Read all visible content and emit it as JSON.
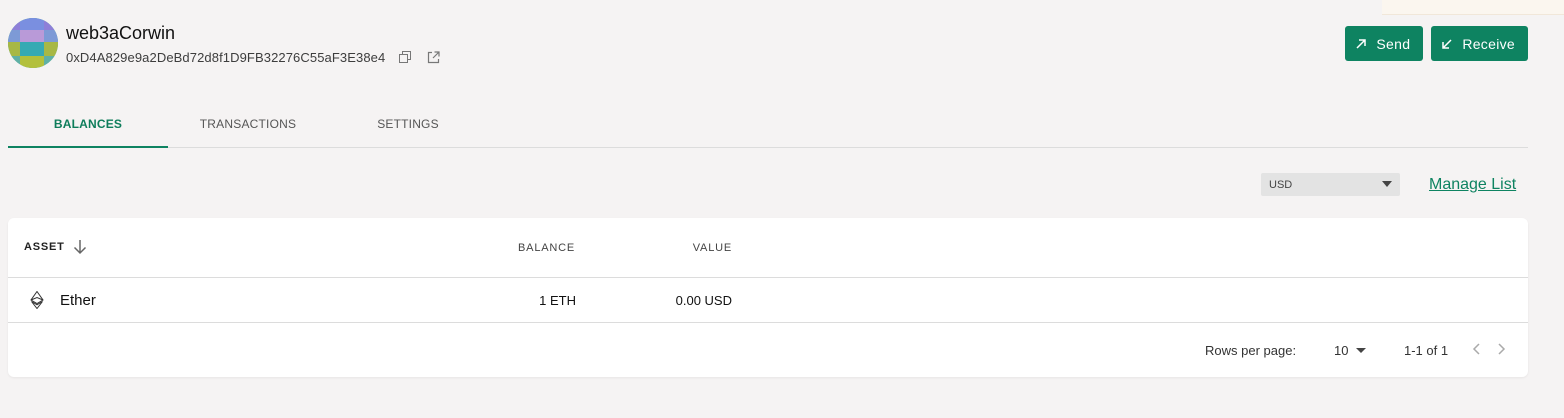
{
  "account": {
    "name": "web3aCorwin",
    "address": "0xD4A829e9a2DeBd72d8f1D9FB32276C55aF3E38e4"
  },
  "actions": {
    "send_label": "Send",
    "receive_label": "Receive"
  },
  "tabs": [
    {
      "label": "BALANCES",
      "active": true
    },
    {
      "label": "TRANSACTIONS",
      "active": false
    },
    {
      "label": "SETTINGS",
      "active": false
    }
  ],
  "currency": {
    "selected": "USD"
  },
  "manage_list_label": "Manage List",
  "table": {
    "columns": {
      "asset": "ASSET",
      "balance": "BALANCE",
      "value": "VALUE"
    },
    "rows": [
      {
        "asset": "Ether",
        "balance": "1 ETH",
        "value": "0.00 USD",
        "icon": "ethereum-icon"
      }
    ]
  },
  "pagination": {
    "rows_per_page_label": "Rows per page:",
    "rows_per_page": "10",
    "range": "1-1 of 1"
  },
  "colors": {
    "accent": "#0e8361",
    "background": "#f5f3f3"
  }
}
